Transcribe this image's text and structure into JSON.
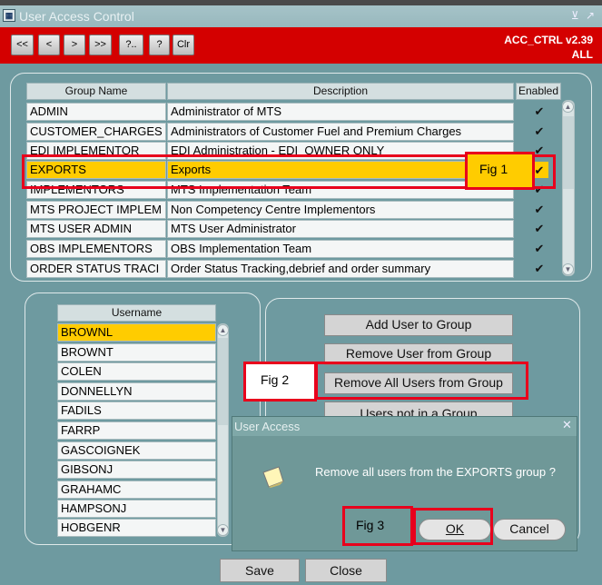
{
  "window": {
    "title": "User Access Control",
    "controls": "⊻ ↗"
  },
  "toolbar": {
    "buttons": [
      "<<",
      "<",
      ">",
      ">>",
      "?..",
      "?",
      "Clr"
    ],
    "version": "ACC_CTRL v2.39",
    "mode": "ALL"
  },
  "groups": {
    "headers": {
      "name": "Group Name",
      "description": "Description",
      "enabled": "Enabled"
    },
    "rows": [
      {
        "name": "ADMIN",
        "description": "Administrator of MTS",
        "enabled": "✔"
      },
      {
        "name": "CUSTOMER_CHARGES",
        "description": "Administrators of Customer Fuel and Premium Charges",
        "enabled": "✔"
      },
      {
        "name": "EDI IMPLEMENTOR",
        "description": "EDI Administration - EDI_OWNER ONLY",
        "enabled": "✔"
      },
      {
        "name": "EXPORTS",
        "description": "Exports",
        "enabled": "✔"
      },
      {
        "name": "IMPLEMENTORS",
        "description": "MTS Implementation Team",
        "enabled": "✔"
      },
      {
        "name": "MTS PROJECT IMPLEM",
        "description": "Non Competency Centre Implementors",
        "enabled": "✔"
      },
      {
        "name": "MTS USER ADMIN",
        "description": "MTS User Administrator",
        "enabled": "✔"
      },
      {
        "name": "OBS IMPLEMENTORS",
        "description": "OBS Implementation Team",
        "enabled": "✔"
      },
      {
        "name": "ORDER STATUS TRACI",
        "description": "Order Status Tracking,debrief and order summary",
        "enabled": "✔"
      }
    ],
    "selected_index": 3
  },
  "users": {
    "header": "Username",
    "rows": [
      "BROWNL",
      "BROWNT",
      "COLEN",
      "DONNELLYN",
      "FADILS",
      "FARRP",
      "GASCOIGNEK",
      "GIBSONJ",
      "GRAHAMC",
      "HAMPSONJ",
      "HOBGENR"
    ],
    "selected_index": 0
  },
  "actions": {
    "add": "Add User to Group",
    "remove": "Remove User from Group",
    "remove_all": "Remove All Users from Group",
    "users_not_in_group": "Users not in a Group"
  },
  "footer": {
    "save": "Save",
    "close": "Close"
  },
  "dialog": {
    "title": "User Access",
    "message": "Remove all users from the EXPORTS group ?",
    "ok": "OK",
    "cancel": "Cancel",
    "close": "✕"
  },
  "annotations": {
    "fig1": "Fig 1",
    "fig2": "Fig 2",
    "fig3": "Fig 3"
  },
  "colors": {
    "toolbar": "#d40000",
    "background": "#6e9aa0",
    "selection": "#ffcc00",
    "annotation": "#e8001c"
  },
  "icons": {
    "dialog": "note-icon",
    "app": "app-icon"
  }
}
